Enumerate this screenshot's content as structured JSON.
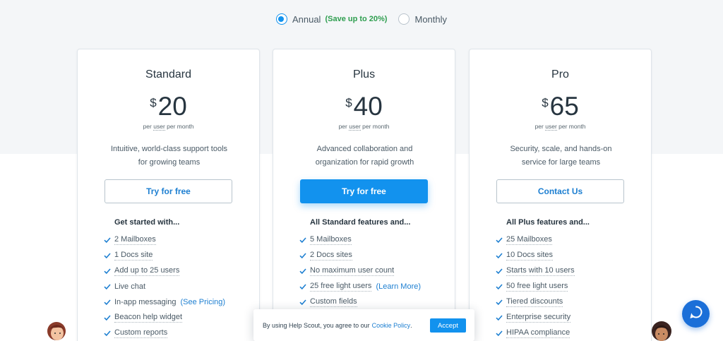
{
  "billing": {
    "annual_label": "Annual",
    "annual_note": "(Save up to 20%)",
    "monthly_label": "Monthly",
    "selected": "annual"
  },
  "plans": [
    {
      "name": "Standard",
      "currency": "$",
      "price": "20",
      "per_prefix": "per",
      "per_user": "user",
      "per_suffix": "per month",
      "desc_line1": "Intuitive, world-class support tools",
      "desc_line2": "for growing teams",
      "cta": "Try for free",
      "features_heading": "Get started with...",
      "features": [
        {
          "text": "2 Mailboxes"
        },
        {
          "text": "1 Docs site"
        },
        {
          "text": "Add up to 25 users"
        },
        {
          "text": "Live chat"
        },
        {
          "text": "In-app messaging",
          "link": "(See Pricing)"
        },
        {
          "text": "Beacon help widget"
        },
        {
          "text": "Custom reports"
        }
      ]
    },
    {
      "name": "Plus",
      "currency": "$",
      "price": "40",
      "per_prefix": "per",
      "per_user": "user",
      "per_suffix": "per month",
      "desc_line1": "Advanced collaboration and",
      "desc_line2": "organization for rapid growth",
      "cta": "Try for free",
      "features_heading": "All Standard features and...",
      "features": [
        {
          "text": "5 Mailboxes"
        },
        {
          "text": "2 Docs sites"
        },
        {
          "text": "No maximum user count"
        },
        {
          "text": "25 free light users",
          "link": "(Learn More)"
        },
        {
          "text": "Custom fields"
        }
      ]
    },
    {
      "name": "Pro",
      "currency": "$",
      "price": "65",
      "per_prefix": "per",
      "per_user": "user",
      "per_suffix": "per month",
      "desc_line1": "Security, scale, and hands-on",
      "desc_line2": "service for large teams",
      "cta": "Contact Us",
      "features_heading": "All Plus features and...",
      "features": [
        {
          "text": "25 Mailboxes"
        },
        {
          "text": "10 Docs sites"
        },
        {
          "text": "Starts with 10 users"
        },
        {
          "text": "50 free light users"
        },
        {
          "text": "Tiered discounts"
        },
        {
          "text": "Enterprise security"
        },
        {
          "text": "HIPAA compliance"
        }
      ]
    }
  ],
  "cookie": {
    "text": "By using Help Scout, you agree to our",
    "link": "Cookie Policy",
    "dot": ".",
    "accept": "Accept"
  },
  "colors": {
    "accent": "#1292ee",
    "check": "#1d7fd1",
    "beacon": "#1b6fd8",
    "save_green": "#2e9e4f"
  }
}
